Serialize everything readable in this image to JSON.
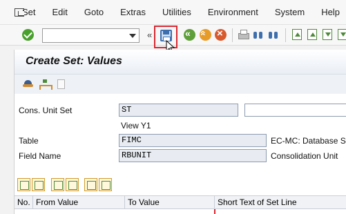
{
  "menu": {
    "items": [
      {
        "label": "Set"
      },
      {
        "label": "Edit"
      },
      {
        "label": "Goto"
      },
      {
        "label": "Extras"
      },
      {
        "label": "Utilities"
      },
      {
        "label": "Environment"
      },
      {
        "label": "System"
      },
      {
        "label": "Help"
      }
    ]
  },
  "toolbar": {
    "command_value": "",
    "collapse_glyph": "«"
  },
  "screen": {
    "title": "Create Set: Values"
  },
  "form": {
    "cons_unit_set": {
      "label": "Cons. Unit Set",
      "value": "ST",
      "description": ""
    },
    "view": "View Y1",
    "table": {
      "label": "Table",
      "value": "FIMC",
      "description": "EC-MC: Database Stru"
    },
    "field_name": {
      "label": "Field Name",
      "value": "RBUNIT",
      "description": "Consolidation Unit"
    }
  },
  "table": {
    "columns": [
      "No.",
      "From Value",
      "To Value",
      "Short Text of Set Line"
    ]
  }
}
